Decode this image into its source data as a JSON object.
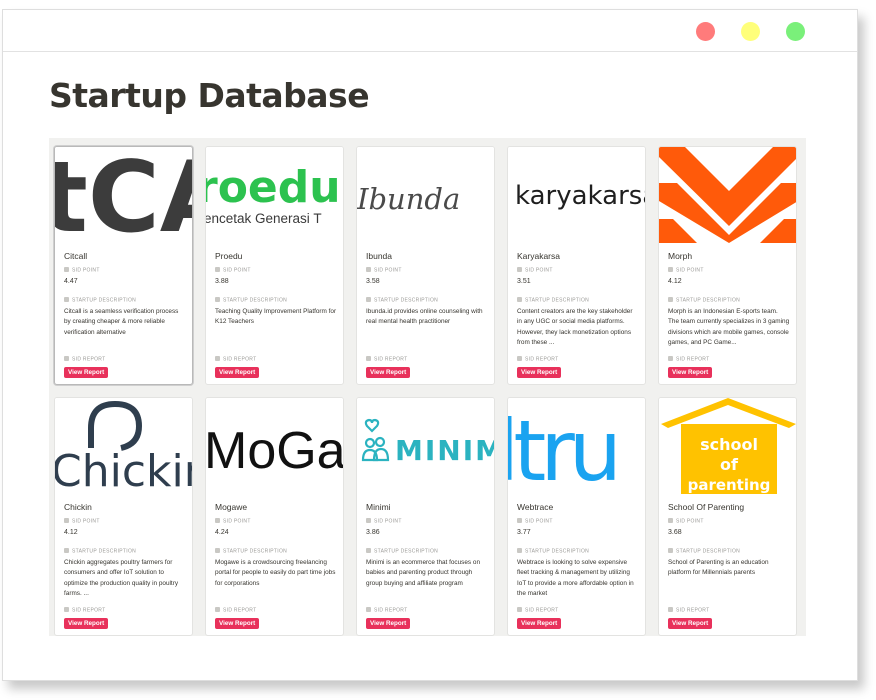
{
  "page": {
    "title": "Startup Database"
  },
  "window": {
    "buttons": [
      "close",
      "minimize",
      "maximize"
    ]
  },
  "labels": {
    "score": "SID POINT",
    "description": "STARTUP DESCRIPTION",
    "report": "SID REPORT",
    "button": "View Report"
  },
  "cards": [
    {
      "name": "Citcall",
      "score": "4.47",
      "description": "Citcall is a seamless verification process by creating cheaper & more reliable verification alternative",
      "cover_text": "tCA"
    },
    {
      "name": "Proedu",
      "score": "3.88",
      "description": "Teaching Quality Improvement Platform for K12 Teachers",
      "cover_text": "roedu",
      "cover_text_2": "encetak Generasi T"
    },
    {
      "name": "Ibunda",
      "score": "3.58",
      "description": "Ibunda.id provides online counseling with real mental health practitioner",
      "cover_text": "Ibunda"
    },
    {
      "name": "Karyakarsa",
      "score": "3.51",
      "description": "Content creators are the key stakeholder in any UGC or social media platforms. However, they lack monetization options from these ...",
      "cover_text": "karyakarsa"
    },
    {
      "name": "Morph",
      "score": "4.12",
      "description": "Morph is an Indonesian E-sports team. The team currently specializes in 3 gaming divisions which are mobile games, console games, and PC Game...",
      "cover_text": ""
    },
    {
      "name": "Chickin",
      "score": "4.12",
      "description": "Chickin aggregates poultry farmers for consumers and offer IoT solution to optimize the production quality in poultry farms. ...",
      "cover_text": "Chickin"
    },
    {
      "name": "Mogawe",
      "score": "4.24",
      "description": "Mogawe is a crowdsourcing freelancing portal for people to easily do part time jobs for corporations",
      "cover_text": "MoGa"
    },
    {
      "name": "Minimi",
      "score": "3.86",
      "description": "Minimi is an ecommerce that focuses on babies and parenting product through group buying and affiliate program",
      "cover_text": "MINIM"
    },
    {
      "name": "Webtrace",
      "score": "3.77",
      "description": "Webtrace is looking to solve expensive fleet tracking & management by utilizing IoT to provide a more affordable option in the market",
      "cover_text": "ltru"
    },
    {
      "name": "School Of Parenting",
      "score": "3.68",
      "description": "School of Parenting is an education platform for Millennials parents",
      "cover_text": "school",
      "cover_text_2": "of",
      "cover_text_3": "parenting"
    }
  ],
  "colors": {
    "accent_button": "#e8315b",
    "proedu_green": "#2cc24f",
    "morph_orange": "#ff5a0a",
    "minimi_teal": "#2bb3c0",
    "webtrace_blue": "#1aa3f0",
    "school_yellow": "#ffc200"
  }
}
